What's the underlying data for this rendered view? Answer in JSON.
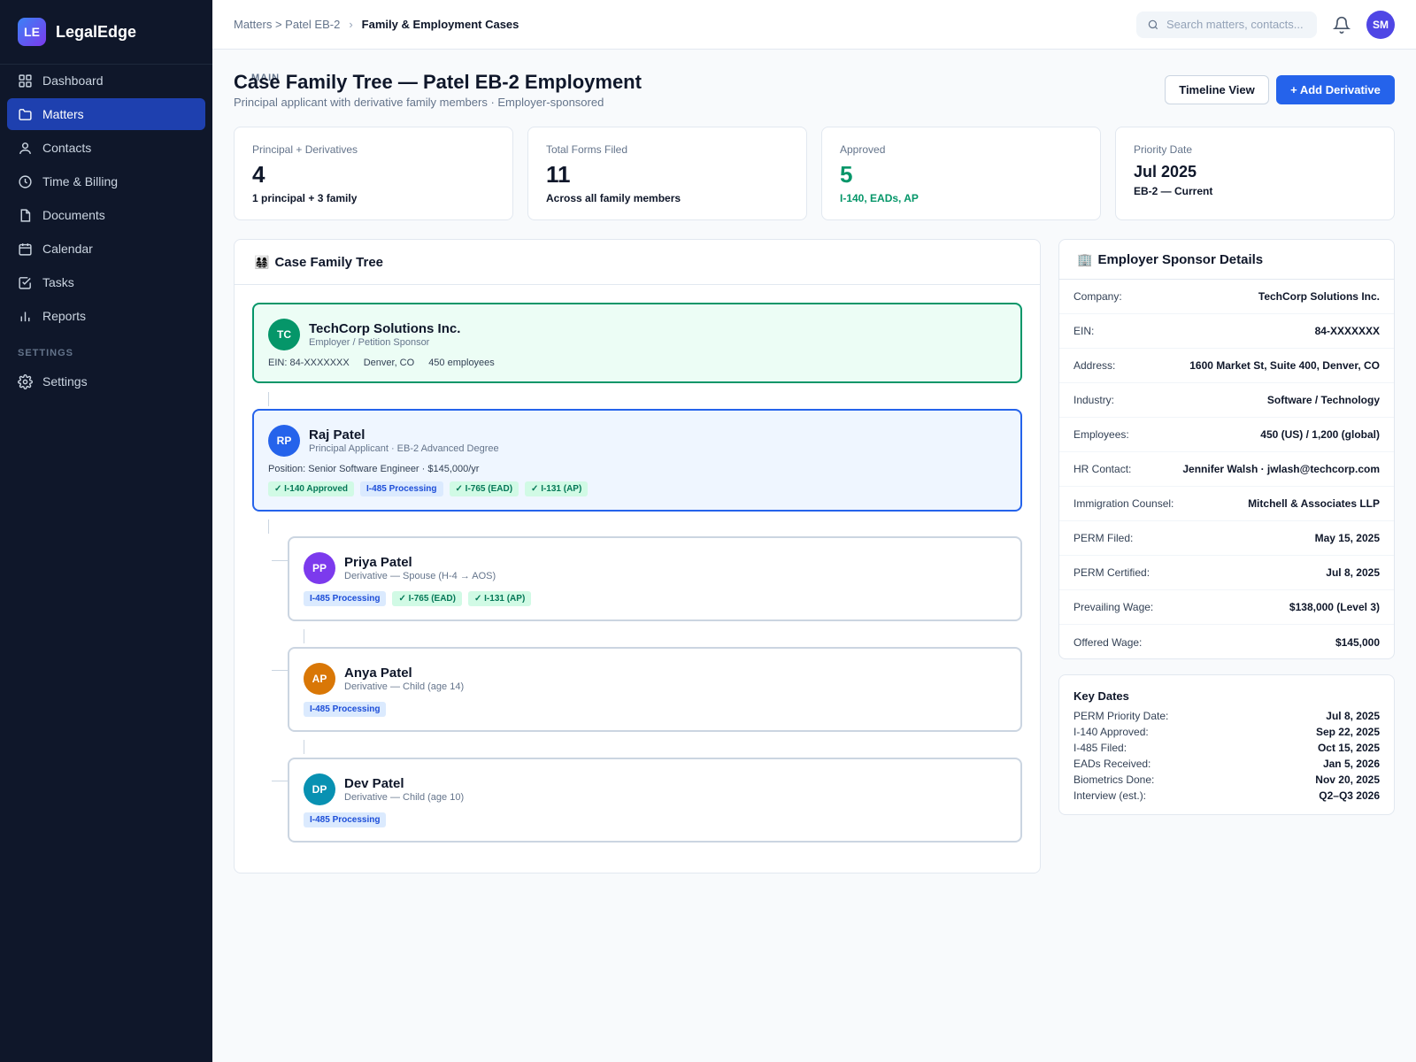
{
  "brand": {
    "logo": "LE",
    "name": "LegalEdge"
  },
  "sidebar": {
    "main_label": "MAIN",
    "settings_label": "SETTINGS",
    "items": [
      {
        "label": "Dashboard",
        "icon": "grid-icon"
      },
      {
        "label": "Matters",
        "icon": "folder-icon",
        "active": true
      },
      {
        "label": "Contacts",
        "icon": "user-icon"
      },
      {
        "label": "Time & Billing",
        "icon": "clock-icon"
      },
      {
        "label": "Documents",
        "icon": "document-icon"
      },
      {
        "label": "Calendar",
        "icon": "calendar-icon"
      },
      {
        "label": "Tasks",
        "icon": "checkbox-icon"
      },
      {
        "label": "Reports",
        "icon": "bar-chart-icon"
      }
    ],
    "settings_item": {
      "label": "Settings",
      "icon": "gear-icon"
    }
  },
  "topbar": {
    "breadcrumb_parent": "Matters > Patel EB-2",
    "breadcrumb_sep": "›",
    "breadcrumb_current": "Family & Employment Cases",
    "search_placeholder": "Search matters, contacts...",
    "user_initials": "SM"
  },
  "page": {
    "title": "Case Family Tree — Patel EB-2 Employment",
    "subtitle": "Principal applicant with derivative family members · Employer-sponsored",
    "timeline_button": "Timeline View",
    "add_button": "+ Add Derivative"
  },
  "stats": [
    {
      "label": "Principal + Derivatives",
      "value": "4",
      "note": "1 principal + 3 family"
    },
    {
      "label": "Total Forms Filed",
      "value": "11",
      "note": "Across all family members"
    },
    {
      "label": "Approved",
      "value": "5",
      "note": "I-140, EADs, AP"
    },
    {
      "label": "Priority Date",
      "value": "Jul 2025",
      "note": "EB-2 — Current"
    }
  ],
  "tree": {
    "title": "Case Family Tree",
    "title_emoji": "👨‍👩‍👧‍👦",
    "employer": {
      "initials": "TC",
      "name": "TechCorp Solutions Inc.",
      "role": "Employer / Petition Sponsor",
      "ein": "EIN: 84-XXXXXXX",
      "location": "Denver, CO",
      "employees": "450 employees"
    },
    "principal": {
      "initials": "RP",
      "name": "Raj Patel",
      "role": "Principal Applicant · EB-2 Advanced Degree",
      "position": "Position: Senior Software Engineer · $145,000/yr",
      "badges": [
        "✓ I-140 Approved",
        "I-485 Processing",
        "✓ I-765 (EAD)",
        "✓ I-131 (AP)"
      ]
    },
    "derivatives": [
      {
        "initials": "PP",
        "name": "Priya Patel",
        "role": "Derivative — Spouse (H-4 → AOS)",
        "badges": [
          "I-485 Processing",
          "✓ I-765 (EAD)",
          "✓ I-131 (AP)"
        ]
      },
      {
        "initials": "AP",
        "name": "Anya Patel",
        "role": "Derivative — Child (age 14)",
        "badges": [
          "I-485 Processing"
        ]
      },
      {
        "initials": "DP",
        "name": "Dev Patel",
        "role": "Derivative — Child (age 10)",
        "badges": [
          "I-485 Processing"
        ]
      }
    ]
  },
  "sponsor": {
    "title": "Employer Sponsor Details",
    "title_emoji": "🏢",
    "rows": [
      {
        "k": "Company:",
        "v": "TechCorp Solutions Inc."
      },
      {
        "k": "EIN:",
        "v": "84-XXXXXXX"
      },
      {
        "k": "Address:",
        "v": "1600 Market St, Suite 400, Denver, CO"
      },
      {
        "k": "Industry:",
        "v": "Software / Technology"
      },
      {
        "k": "Employees:",
        "v": "450 (US) / 1,200 (global)"
      },
      {
        "k": "HR Contact:",
        "v": "Jennifer Walsh · jwlash@techcorp.com"
      },
      {
        "k": "Immigration Counsel:",
        "v": "Mitchell & Associates LLP"
      },
      {
        "k": "PERM Filed:",
        "v": "May 15, 2025"
      },
      {
        "k": "PERM Certified:",
        "v": "Jul 8, 2025"
      },
      {
        "k": "Prevailing Wage:",
        "v": "$138,000 (Level 3)"
      },
      {
        "k": "Offered Wage:",
        "v": "$145,000"
      }
    ]
  },
  "key_dates": {
    "title": "Key Dates",
    "rows": [
      {
        "k": "PERM Priority Date:",
        "v": "Jul 8, 2025"
      },
      {
        "k": "I-140 Approved:",
        "v": "Sep 22, 2025"
      },
      {
        "k": "I-485 Filed:",
        "v": "Oct 15, 2025"
      },
      {
        "k": "EADs Received:",
        "v": "Jan 5, 2026"
      },
      {
        "k": "Biometrics Done:",
        "v": "Nov 20, 2025"
      },
      {
        "k": "Interview (est.):",
        "v": "Q2–Q3 2026"
      }
    ]
  },
  "colors": {
    "sidebar_bg": "#0f172a",
    "active_nav": "#1e40af",
    "primary": "#2563eb",
    "success": "#059669",
    "employer_avatar": "#059669",
    "principal_avatar": "#2563eb",
    "spouse_avatar": "#7c3aed",
    "child1_avatar": "#d97706",
    "child2_avatar": "#0891b2"
  }
}
